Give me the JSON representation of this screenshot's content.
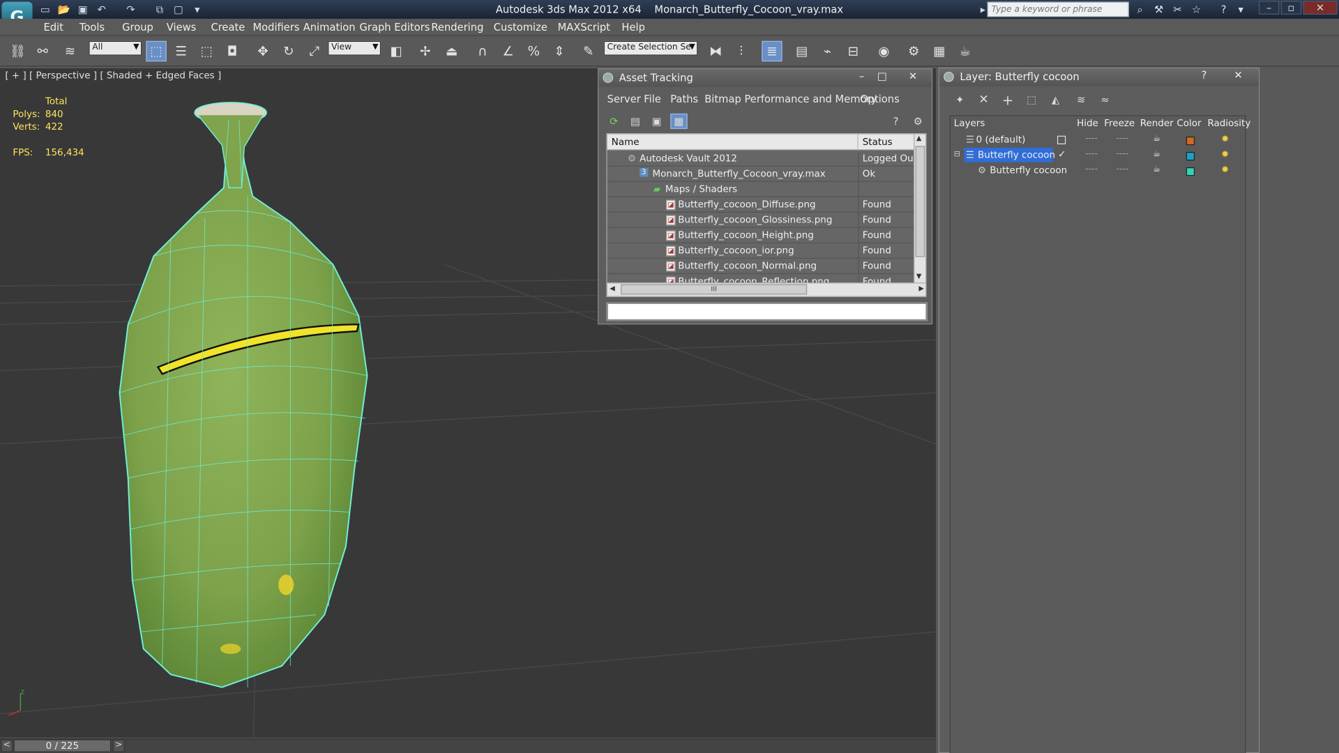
{
  "app": {
    "title": "Autodesk 3ds Max  2012 x64",
    "filename": "Monarch_Butterfly_Cocoon_vray.max",
    "search_placeholder": "Type a keyword or phrase"
  },
  "menu": [
    "Edit",
    "Tools",
    "Group",
    "Views",
    "Create",
    "Modifiers",
    "Animation",
    "Graph Editors",
    "Rendering",
    "Customize",
    "MAXScript",
    "Help"
  ],
  "toolbar": {
    "filter_value": "All",
    "refcoord_value": "View",
    "selection_set_placeholder": "Create Selection Se"
  },
  "viewport": {
    "label": "[ + ] [ Perspective ] [ Shaded + Edged Faces ]",
    "stats_header": "Total",
    "polys_label": "Polys:",
    "polys_value": "840",
    "verts_label": "Verts:",
    "verts_value": "422",
    "fps_label": "FPS:",
    "fps_value": "156,434",
    "frame_counter": "0 / 225",
    "prev": "<",
    "next": ">"
  },
  "asset_tracking": {
    "title": "Asset Tracking",
    "menus": [
      "Server",
      "File",
      "Paths",
      "Bitmap Performance and Memory",
      "Options"
    ],
    "columns": {
      "name": "Name",
      "status": "Status"
    },
    "rows": [
      {
        "name": "Autodesk Vault 2012",
        "status": "Logged Out ..."
      },
      {
        "name": "Monarch_Butterfly_Cocoon_vray.max",
        "status": "Ok"
      },
      {
        "name": "Maps / Shaders",
        "status": ""
      },
      {
        "name": "Butterfly_cocoon_Diffuse.png",
        "status": "Found"
      },
      {
        "name": "Butterfly_cocoon_Glossiness.png",
        "status": "Found"
      },
      {
        "name": "Butterfly_cocoon_Height.png",
        "status": "Found"
      },
      {
        "name": "Butterfly_cocoon_ior.png",
        "status": "Found"
      },
      {
        "name": "Butterfly_cocoon_Normal.png",
        "status": "Found"
      },
      {
        "name": "Butterfly_cocoon_Reflection.png",
        "status": "Found"
      }
    ],
    "max_badge": "3",
    "scroll_grip": "III"
  },
  "layer_panel": {
    "title": "Layer: Butterfly cocoon",
    "columns": {
      "layers": "Layers",
      "hide": "Hide",
      "freeze": "Freeze",
      "render": "Render",
      "color": "Color",
      "radiosity": "Radiosity"
    },
    "rows": [
      {
        "name": "0 (default)",
        "color": "#d06a28"
      },
      {
        "name": "Butterfly cocoon",
        "color": "#1aa3c9"
      },
      {
        "name": "Butterfly cocoon",
        "color": "#2fd6b5"
      }
    ]
  }
}
